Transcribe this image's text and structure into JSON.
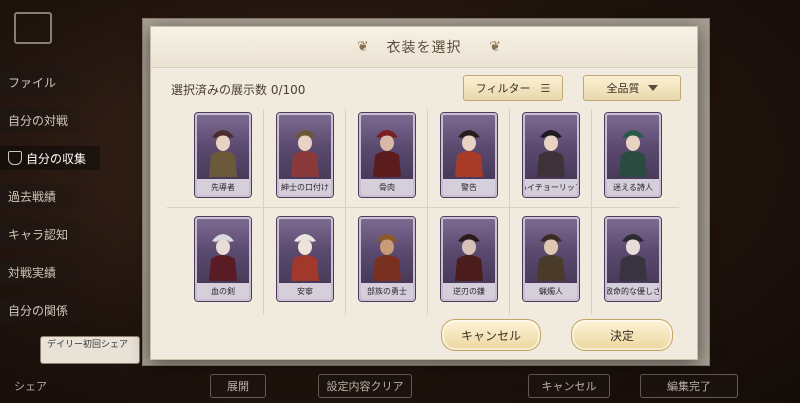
{
  "background": {
    "menu_items": [
      "ファイル",
      "自分の対戦",
      "自分の収集",
      "過去戦績",
      "キャラ認知",
      "対戦実績",
      "自分の関係"
    ],
    "active_index": 2,
    "share_bubble": "デイリー初回シェア",
    "share_label": "シェア",
    "bottom_buttons": [
      "展開",
      "設定内容クリア",
      "キャンセル",
      "編集完了"
    ]
  },
  "modal": {
    "title": "衣装を選択",
    "count_text": "選択済みの展示数 0/100",
    "filter_label": "フィルター",
    "quality_label": "全品質",
    "cancel_label": "キャンセル",
    "confirm_label": "決定"
  },
  "costumes": [
    {
      "name": "先導者",
      "hat": "#4a2c2c",
      "coat": "#6b5a3a",
      "skin": "#e8d2c2"
    },
    {
      "name": "紳士の口付け",
      "hat": "#6b5637",
      "coat": "#8a3a3a",
      "skin": "#e8d2c2"
    },
    {
      "name": "骨肉",
      "hat": "#7a2020",
      "coat": "#5a1c1c",
      "skin": "#d9b8a8"
    },
    {
      "name": "警告",
      "hat": "#2a1c1c",
      "coat": "#a83a28",
      "skin": "#e8d2c2"
    },
    {
      "name": "ハイチョーリップ",
      "hat": "#1e1a22",
      "coat": "#3c3238",
      "skin": "#e8d2c2"
    },
    {
      "name": "迷える詩人",
      "hat": "#2c5a4a",
      "coat": "#2a4c40",
      "skin": "#e8d2c2"
    },
    {
      "name": "血の剣",
      "hat": "#d8d8de",
      "coat": "#5a1c24",
      "skin": "#e8dcd8"
    },
    {
      "name": "安寧",
      "hat": "#e8e4e0",
      "coat": "#a0382c",
      "skin": "#efe2da"
    },
    {
      "name": "部族の勇士",
      "hat": "#8a5a2a",
      "coat": "#7a3020",
      "skin": "#c89a78"
    },
    {
      "name": "逆刃の鎌",
      "hat": "#2a1a1a",
      "coat": "#4a1c1c",
      "skin": "#d8c2b8"
    },
    {
      "name": "蝋燭人",
      "hat": "#3a2c22",
      "coat": "#4a3a2a",
      "skin": "#e0c8b0"
    },
    {
      "name": "致命的な優しさ",
      "hat": "#2a2a30",
      "coat": "#3a3440",
      "skin": "#e8dcd8"
    }
  ]
}
